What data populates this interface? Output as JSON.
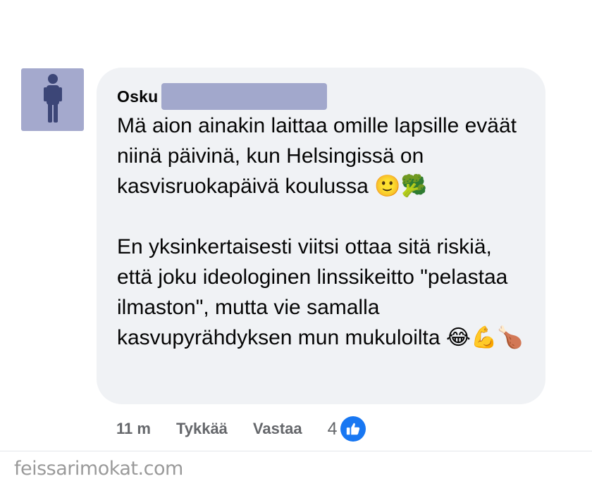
{
  "comment": {
    "author": "Osku",
    "paragraphs": [
      "Mä aion ainakin laittaa omille lapsille eväät niinä päivinä, kun Helsingissä on kasvisruokapäivä koulussa 🙂🥦",
      "En yksinkertaisesti viitsi ottaa sitä riskiä, että joku ideologinen linssikeitto \"pelastaa ilmaston\", mutta vie samalla kasvupyrähdyksen mun mukuloilta 😂💪🍗"
    ]
  },
  "actions": {
    "timestamp": "11 m",
    "like_label": "Tykkää",
    "reply_label": "Vastaa",
    "reaction_count": "4"
  },
  "watermark": "feissarimokat.com",
  "colors": {
    "bubble_bg": "#f0f2f5",
    "avatar_bg": "#a4a9cd",
    "redaction": "#a2a8cc",
    "meta_text": "#65676b",
    "like_blue": "#1877f2"
  },
  "icons": {
    "avatar": "person-silhouette-icon",
    "reaction": "thumbs-up-icon"
  }
}
